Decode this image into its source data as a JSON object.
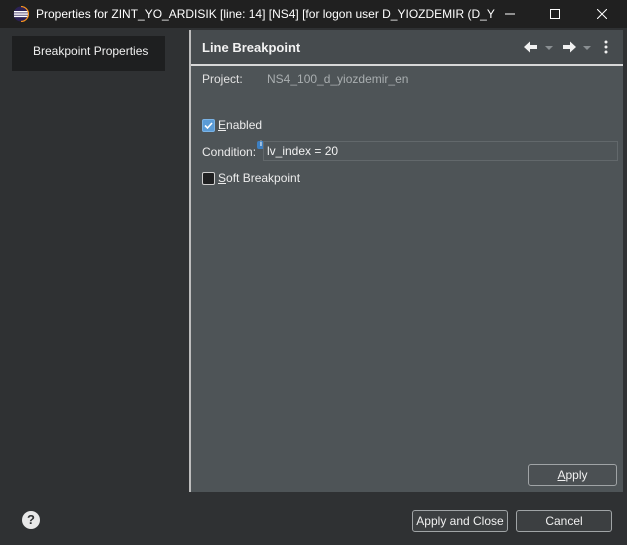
{
  "window": {
    "title": "Properties for ZINT_YO_ARDISIK [line: 14] [NS4] [for logon user D_YIOZDEMIR (D_YI..."
  },
  "sidebar": {
    "items": [
      {
        "label": "Breakpoint Properties"
      }
    ]
  },
  "page": {
    "title": "Line Breakpoint",
    "project_label": "Project:",
    "project_value": "NS4_100_d_yiozdemir_en",
    "enabled": {
      "mnemonic": "E",
      "rest": "nabled",
      "checked": true
    },
    "condition": {
      "label": "Condition:",
      "value": "lv_index = 20"
    },
    "soft_breakpoint": {
      "mnemonic": "S",
      "rest": "oft Breakpoint",
      "checked": false
    },
    "apply": {
      "mnemonic": "A",
      "rest": "pply"
    }
  },
  "footer": {
    "apply_close_label": "Apply and Close",
    "cancel_label": "Cancel"
  },
  "icons": {
    "app": "eclipse-icon",
    "help": "help-icon",
    "back": "back-arrow-icon",
    "forward": "forward-arrow-icon",
    "menu": "view-menu-icon"
  },
  "colors": {
    "accent": "#5a9bd6",
    "page_bg": "#4e5457",
    "sidebar_bg": "#2f3133",
    "titlebar_bg": "#202020"
  }
}
